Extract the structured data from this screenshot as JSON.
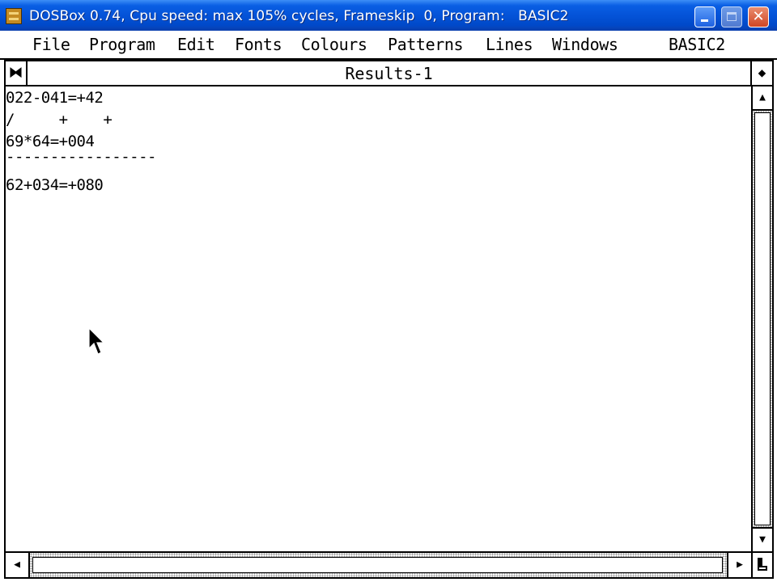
{
  "host_window": {
    "title": "DOSBox 0.74, Cpu speed: max 105% cycles, Frameskip  0, Program:   BASIC2",
    "icon": "dosbox-icon",
    "buttons": {
      "minimize": "minimize-icon",
      "maximize": "maximize-icon",
      "close_label": "✕"
    }
  },
  "menubar": {
    "items": [
      "File",
      "Program",
      "Edit",
      "Fonts",
      "Colours",
      "Patterns",
      "Lines",
      "Windows"
    ],
    "program_name": "BASIC2"
  },
  "results_window": {
    "title": "Results-1",
    "closer_glyph": "⧓",
    "fuller_glyph": "◆",
    "lines": [
      "022-041=+42",
      "/     +    +",
      "69*64=+004",
      "-----------------",
      "62+034=+080"
    ]
  },
  "scrollbars": {
    "up_glyph": "▲",
    "down_glyph": "▼",
    "left_glyph": "◀",
    "right_glyph": "▶"
  },
  "cursor": "arrow-pointer-icon"
}
